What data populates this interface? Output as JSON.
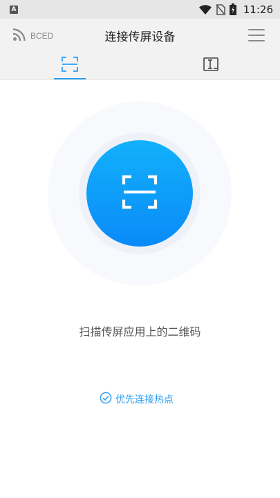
{
  "status_bar": {
    "notification_letter": "A",
    "time": "11:26",
    "icons": [
      "notification-a-icon",
      "wifi-icon",
      "no-sim-icon",
      "battery-charging-icon"
    ]
  },
  "header": {
    "rss_label": "BCED",
    "title": "连接传屏设备",
    "icons": [
      "rss-icon",
      "menu-icon"
    ]
  },
  "tabs": [
    {
      "name": "scan",
      "icon": "scan-tab-icon",
      "active": true
    },
    {
      "name": "code",
      "icon": "code-input-tab-icon",
      "active": false
    }
  ],
  "main": {
    "scan_button_icon": "scan-frame-icon",
    "instruction": "扫描传屏应用上的二维码",
    "hotspot_label": "优先连接热点",
    "hotspot_checked": true
  },
  "colors": {
    "accent": "#2a9ef4",
    "scan_gradient_top": "#12b1fb",
    "scan_gradient_bottom": "#0a8af7",
    "header_bg": "#f2f2f2",
    "status_bg": "#e6e6e6"
  }
}
